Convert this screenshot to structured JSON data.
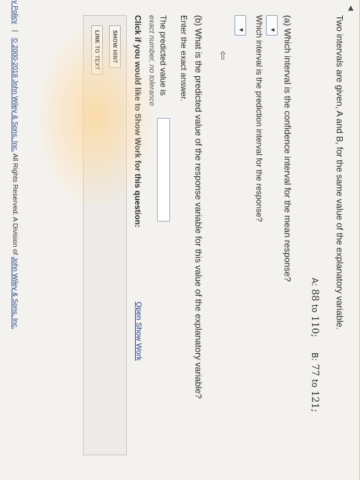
{
  "question": {
    "intro": "Two intervals are given, A and B, for the same value of the explanatory variable.",
    "interval_a_label": "A:",
    "interval_a_low": "88",
    "interval_a_to": "to",
    "interval_a_high": "110",
    "interval_a_sep": ";",
    "interval_b_label": "B:",
    "interval_b_low": "77",
    "interval_b_to": "to",
    "interval_b_high": "121",
    "interval_b_sep": ";",
    "part_a": "(a) Which interval is the confidence interval for the mean response?",
    "part_a2": "Which interval is the prediction interval for the response?",
    "part_b": "(b) What is the predicted value of the response variable for this value of the explanatory variable?",
    "exact_answer": "Enter the exact answer.",
    "predicted_label": "The predicted value is",
    "predicted_value": "",
    "tolerance_note": "exact number, no tolerance",
    "show_work_prompt": "Click if you would like to Show Work for this question:",
    "show_work_link": "Open Show Work"
  },
  "dropdowns": {
    "confidence_selected": "",
    "prediction_selected": ""
  },
  "buttons": {
    "show_hint": "SHOW HINT",
    "link_to_text": "LINK TO TEXT"
  },
  "footer": {
    "privacy": "acy Policy",
    "separator": "|",
    "copyright_prefix": "© 2000-2018 John Wiley & Sons, Inc.",
    "rights": "All Rights Reserved. A Division of",
    "company_link": "John Wiley & Sons, Inc."
  },
  "icons": {
    "dropdown_arrow": "chevron-down-icon",
    "mouse_cursor": "cursor-icon",
    "scroll_arrow": "triangle-left-icon"
  },
  "colors": {
    "link": "#1c3f8a",
    "glare": "#ffd696"
  }
}
